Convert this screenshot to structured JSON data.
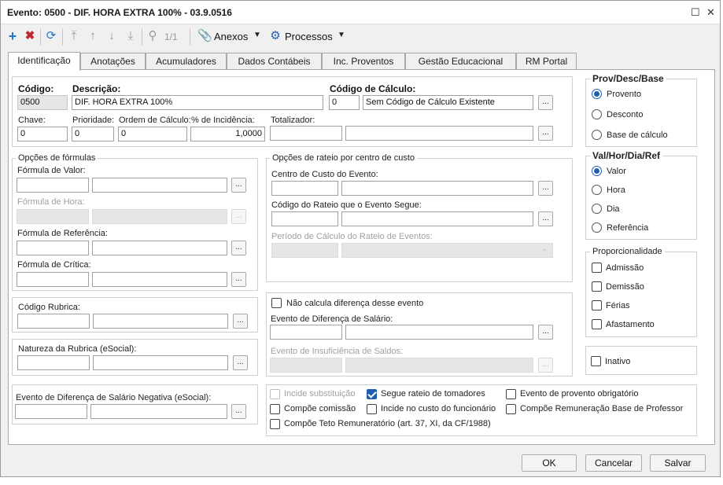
{
  "window": {
    "title": "Evento: 0500 - DIF. HORA EXTRA 100% - 03.9.0516",
    "restore": "☐",
    "close": "✕"
  },
  "toolbar": {
    "page": "1/1",
    "anexos": "Anexos",
    "processos": "Processos"
  },
  "tabs": [
    "Identificação",
    "Anotações",
    "Acumuladores",
    "Dados Contábeis",
    "Inc. Proventos",
    "Gestão Educacional",
    "RM Portal"
  ],
  "main": {
    "codigo_label": "Código:",
    "codigo_value": "0500",
    "descricao_label": "Descrição:",
    "descricao_value": "DIF. HORA EXTRA 100%",
    "codcalc_label": "Código de Cálculo:",
    "codcalc_value": "0",
    "codcalc_desc": "Sem Código de Cálculo Existente",
    "chave_label": "Chave:",
    "chave_value": "0",
    "prioridade_label": "Prioridade:",
    "prioridade_value": "0",
    "ordem_label": "Ordem de Cálculo:",
    "ordem_value": "0",
    "incidencia_label": "% de Incidência:",
    "incidencia_value": "1,0000",
    "totalizador_label": "Totalizador:"
  },
  "formulas": {
    "title": "Opções de fórmulas",
    "valor": "Fórmula de Valor:",
    "hora": "Fórmula de Hora:",
    "referencia": "Fórmula de Referência:",
    "critica": "Fórmula de Crítica:"
  },
  "rateio": {
    "title": "Opções de rateio por centro de custo",
    "centro": "Centro de Custo do Evento:",
    "codigo": "Código do Rateio que o Evento Segue:",
    "periodo": "Período de Cálculo do Rateio de Eventos:"
  },
  "rubrica": {
    "codigo": "Código Rubrica:",
    "natureza": "Natureza da Rubrica (eSocial):",
    "negativa": "Evento de Diferença de Salário Negativa (eSocial):"
  },
  "diferenca": {
    "nao_calcula": "Não calcula diferença desse evento",
    "evento_dif": "Evento de Diferença de Salário:",
    "evento_insuf": "Evento de Insuficiência de Saldos:"
  },
  "checks": {
    "incide_subst": "Incide substituição",
    "segue_rateio": "Segue rateio de tomadores",
    "provento_obrig": "Evento de provento obrigatório",
    "compoe_comissao": "Compõe comissão",
    "incide_custo": "Incide no custo do funcionário",
    "compoe_remun": "Compõe Remuneração Base de Professor",
    "compoe_teto": "Compõe Teto Remuneratório (art. 37, XI, da CF/1988)"
  },
  "prov": {
    "title": "Prov/Desc/Base",
    "options": [
      "Provento",
      "Desconto",
      "Base de cálculo"
    ]
  },
  "val": {
    "title": "Val/Hor/Dia/Ref",
    "options": [
      "Valor",
      "Hora",
      "Dia",
      "Referência"
    ]
  },
  "prop": {
    "title": "Proporcionalidade",
    "options": [
      "Admissão",
      "Demissão",
      "Férias",
      "Afastamento"
    ]
  },
  "inativo": "Inativo",
  "footer": {
    "ok": "OK",
    "cancelar": "Cancelar",
    "salvar": "Salvar"
  },
  "colors": {
    "accent": "#1f5fb0",
    "add": "#1f77c9",
    "delete": "#c0272d"
  }
}
